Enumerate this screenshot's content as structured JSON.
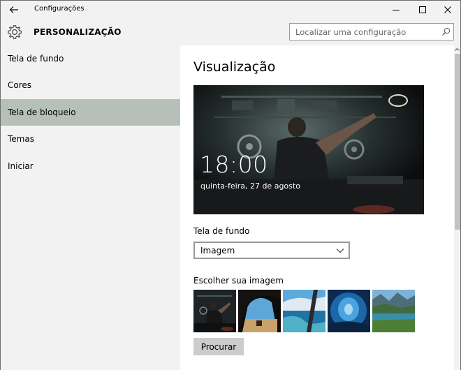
{
  "window": {
    "title": "Configurações"
  },
  "header": {
    "title": "PERSONALIZAÇÃO",
    "search_placeholder": "Localizar uma configuração"
  },
  "sidebar": {
    "items": [
      {
        "label": "Tela de fundo",
        "selected": false
      },
      {
        "label": "Cores",
        "selected": false
      },
      {
        "label": "Tela de bloqueio",
        "selected": true
      },
      {
        "label": "Temas",
        "selected": false
      },
      {
        "label": "Iniciar",
        "selected": false
      }
    ]
  },
  "main": {
    "preview_title": "Visualização",
    "lock_time": "18:00",
    "lock_date": "quinta-feira, 27 de agosto",
    "background_label": "Tela de fundo",
    "background_value": "Imagem",
    "choose_image_label": "Escolher sua imagem",
    "browse_button": "Procurar"
  },
  "colors": {
    "selected_nav": "#b7c0b8",
    "chrome_bg": "#f2f2f2",
    "button_bg": "#cccccc"
  },
  "icons": {
    "back": "back-arrow-icon",
    "settings": "gear-icon",
    "search": "search-icon",
    "dropdown": "chevron-down-icon"
  }
}
